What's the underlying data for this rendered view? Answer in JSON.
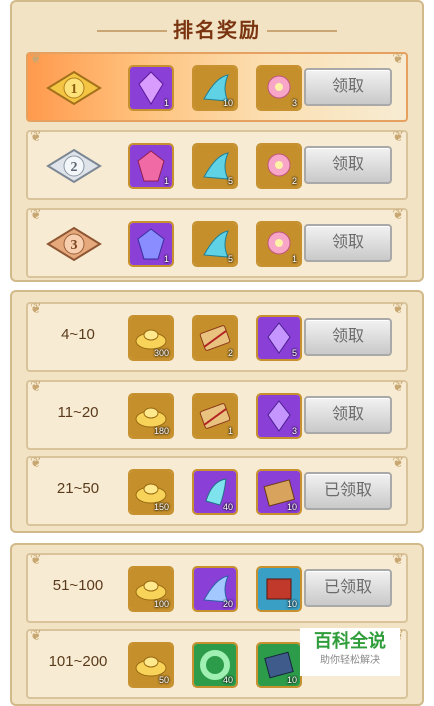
{
  "title": "排名奖励",
  "top_rows": [
    {
      "rank": "1",
      "frame": "gold",
      "items": [
        {
          "icon": "purple-gem-icon",
          "qty": "1",
          "bg": "#8a3fd6",
          "color": "purple"
        },
        {
          "icon": "tail-fin-item-icon",
          "qty": "10",
          "bg": "#c58f2b",
          "color": "gold"
        },
        {
          "icon": "pink-lotus-icon",
          "qty": "3",
          "bg": "#c58f2b",
          "color": "gold"
        }
      ],
      "button": "领取"
    },
    {
      "rank": "2",
      "frame": "plain",
      "items": [
        {
          "icon": "pink-gem-icon",
          "qty": "1",
          "bg": "#8a3fd6",
          "color": "purple"
        },
        {
          "icon": "tail-fin-item-icon",
          "qty": "5",
          "bg": "#c58f2b",
          "color": "gold"
        },
        {
          "icon": "pink-lotus-icon",
          "qty": "2",
          "bg": "#c58f2b",
          "color": "gold"
        }
      ],
      "button": "领取"
    },
    {
      "rank": "3",
      "frame": "plain",
      "items": [
        {
          "icon": "blue-gem-icon",
          "qty": "1",
          "bg": "#8a3fd6",
          "color": "purple"
        },
        {
          "icon": "tail-fin-item-icon",
          "qty": "5",
          "bg": "#c58f2b",
          "color": "gold"
        },
        {
          "icon": "pink-lotus-icon",
          "qty": "1",
          "bg": "#c58f2b",
          "color": "gold"
        }
      ],
      "button": "领取"
    }
  ],
  "range_rows": [
    {
      "range": "4~10",
      "items": [
        {
          "icon": "gold-ingot-icon",
          "qty": "300",
          "bg": "#c58f2b"
        },
        {
          "icon": "fashion-scroll-icon",
          "qty": "2",
          "bg": "#c58f2b"
        },
        {
          "icon": "purple-crystal-icon",
          "qty": "5",
          "bg": "#8a3fd6"
        }
      ],
      "button": "领取"
    },
    {
      "range": "11~20",
      "items": [
        {
          "icon": "gold-ingot-icon",
          "qty": "180",
          "bg": "#c58f2b"
        },
        {
          "icon": "fashion-scroll-icon",
          "qty": "1",
          "bg": "#c58f2b"
        },
        {
          "icon": "purple-crystal-icon",
          "qty": "3",
          "bg": "#8a3fd6"
        }
      ],
      "button": "领取"
    },
    {
      "range": "21~50",
      "items": [
        {
          "icon": "gold-ingot-icon",
          "qty": "150",
          "bg": "#c58f2b"
        },
        {
          "icon": "blue-fin-item-icon",
          "qty": "40",
          "bg": "#8a3fd6"
        },
        {
          "icon": "fashion-book-icon",
          "qty": "10",
          "bg": "#8a3fd6"
        }
      ],
      "button": "已领取"
    },
    {
      "range": "51~100",
      "items": [
        {
          "icon": "gold-ingot-icon",
          "qty": "100",
          "bg": "#c58f2b"
        },
        {
          "icon": "tail-fin-item-icon",
          "qty": "20",
          "bg": "#8a3fd6"
        },
        {
          "icon": "red-book-icon",
          "qty": "10",
          "bg": "#3a9fc4"
        }
      ],
      "button": "已领取"
    },
    {
      "range": "101~200",
      "items": [
        {
          "icon": "gold-ingot-icon",
          "qty": "50",
          "bg": "#c58f2b"
        },
        {
          "icon": "jade-ring-icon",
          "qty": "40",
          "bg": "#2c9c4a"
        },
        {
          "icon": "fashion-book-icon",
          "qty": "10",
          "bg": "#2c9c4a"
        }
      ],
      "button": ""
    }
  ],
  "watermark": {
    "title": "百科全说",
    "subtitle": "助你轻松解决"
  }
}
